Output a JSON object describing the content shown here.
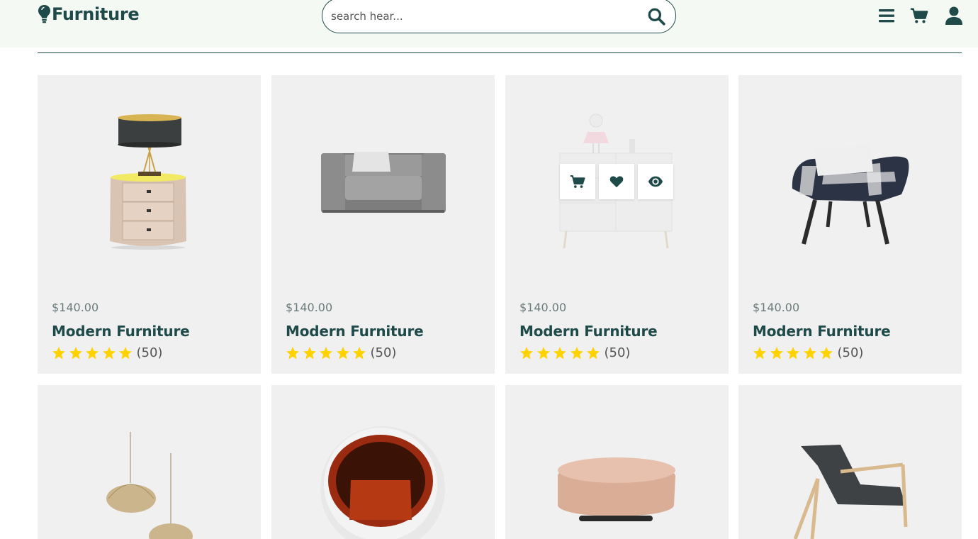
{
  "brand": {
    "name": "Furniture",
    "icon": "lightbulb-icon"
  },
  "search": {
    "placeholder": "search hear...",
    "value": "",
    "icon": "search-icon"
  },
  "header_icons": [
    "menu-icon",
    "cart-icon",
    "user-icon"
  ],
  "colors": {
    "primary": "#1f4a4a",
    "header_bg": "#f4f9f4",
    "card_bg": "#f0f0f0",
    "star": "#ffd200"
  },
  "products": [
    {
      "price": "$140.00",
      "name": "Modern Furniture",
      "rating": 5,
      "reviews": "(50)",
      "image": "lamp-nightstand"
    },
    {
      "price": "$140.00",
      "name": "Modern Furniture",
      "rating": 5,
      "reviews": "(50)",
      "image": "grey-armchair"
    },
    {
      "price": "$140.00",
      "name": "Modern Furniture",
      "rating": 5,
      "reviews": "(50)",
      "image": "white-dresser",
      "hover_actions": [
        "cart-icon",
        "heart-icon",
        "eye-icon"
      ]
    },
    {
      "price": "$140.00",
      "name": "Modern Furniture",
      "rating": 5,
      "reviews": "(50)",
      "image": "plaid-chair"
    },
    {
      "image": "pendant-lamps"
    },
    {
      "image": "ball-chair"
    },
    {
      "image": "ottoman"
    },
    {
      "image": "lounge-chair"
    }
  ]
}
